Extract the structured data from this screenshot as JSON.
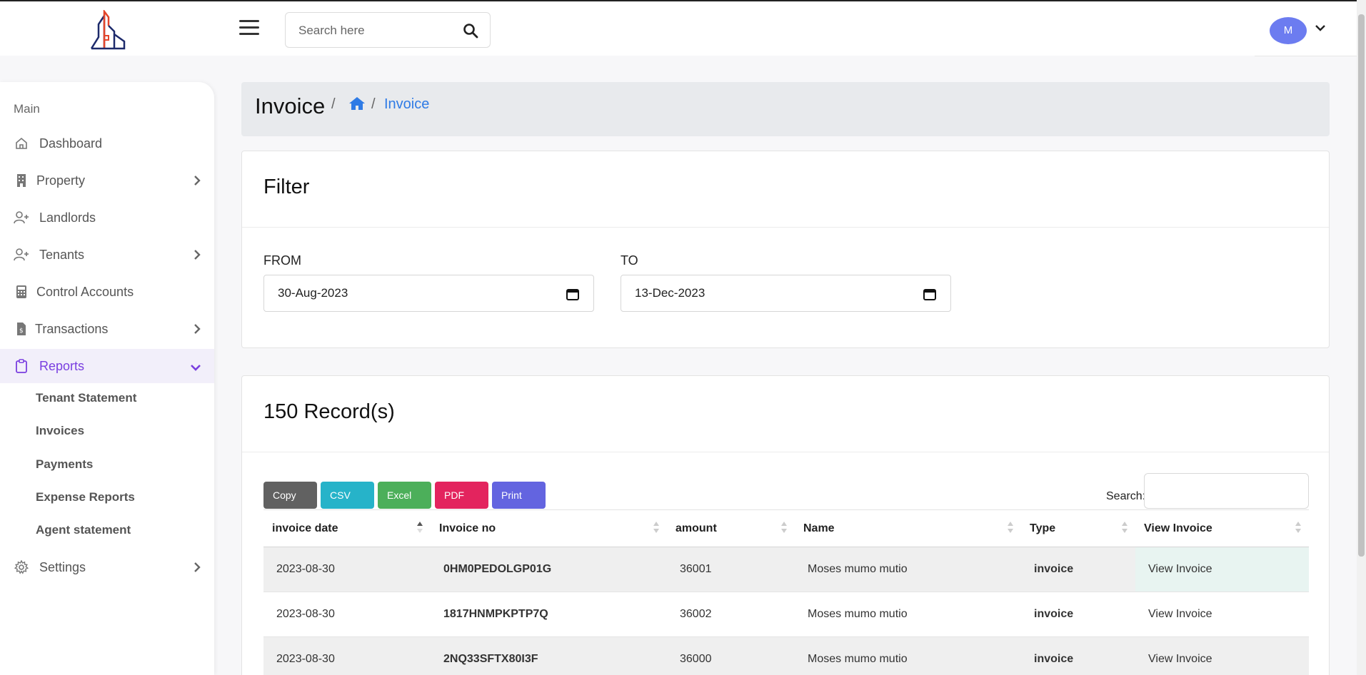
{
  "header": {
    "search_placeholder": "Search here",
    "user_initial": "M"
  },
  "sidebar": {
    "section": "Main",
    "items": [
      {
        "label": "Dashboard",
        "icon": "home-icon"
      },
      {
        "label": "Property",
        "icon": "building-icon"
      },
      {
        "label": "Landlords",
        "icon": "user-plus-icon"
      },
      {
        "label": "Tenants",
        "icon": "user-plus-icon"
      },
      {
        "label": "Control Accounts",
        "icon": "calculator-icon"
      },
      {
        "label": "Transactions",
        "icon": "invoice-icon"
      },
      {
        "label": "Reports",
        "icon": "clipboard-icon"
      },
      {
        "label": "Settings",
        "icon": "gear-icon"
      }
    ],
    "report_subitems": [
      "Tenant Statement",
      "Invoices",
      "Payments",
      "Expense Reports",
      "Agent statement"
    ]
  },
  "breadcrumb": {
    "title": "Invoice",
    "separator": "/",
    "current": "Invoice"
  },
  "filter": {
    "title": "Filter",
    "from_label": "FROM",
    "from_value": "30-Aug-2023",
    "to_label": "TO",
    "to_value": "13-Dec-2023"
  },
  "records": {
    "title": "150 Record(s)",
    "buttons": [
      "Copy",
      "CSV",
      "Excel",
      "PDF",
      "Print"
    ],
    "search_label": "Search:",
    "columns": [
      "invoice date",
      "Invoice no",
      "amount",
      "Name",
      "Type",
      "View Invoice"
    ],
    "rows": [
      {
        "date": "2023-08-30",
        "invoice_no": "0HM0PEDOLGP01G",
        "amount": "36001",
        "name": "Moses mumo mutio",
        "type": "invoice",
        "view": "View Invoice"
      },
      {
        "date": "2023-08-30",
        "invoice_no": "1817HNMPKPTP7Q",
        "amount": "36002",
        "name": "Moses mumo mutio",
        "type": "invoice",
        "view": "View Invoice"
      },
      {
        "date": "2023-08-30",
        "invoice_no": "2NQ33SFTX80I3F",
        "amount": "36000",
        "name": "Moses mumo mutio",
        "type": "invoice",
        "view": "View Invoice"
      }
    ]
  },
  "colors": {
    "accent": "#7a3fe0",
    "link": "#2d6fd0",
    "btn_copy": "#616161",
    "btn_csv": "#26b3c9",
    "btn_excel": "#4caf5a",
    "btn_pdf": "#e3245e",
    "btn_print": "#6364e0"
  }
}
